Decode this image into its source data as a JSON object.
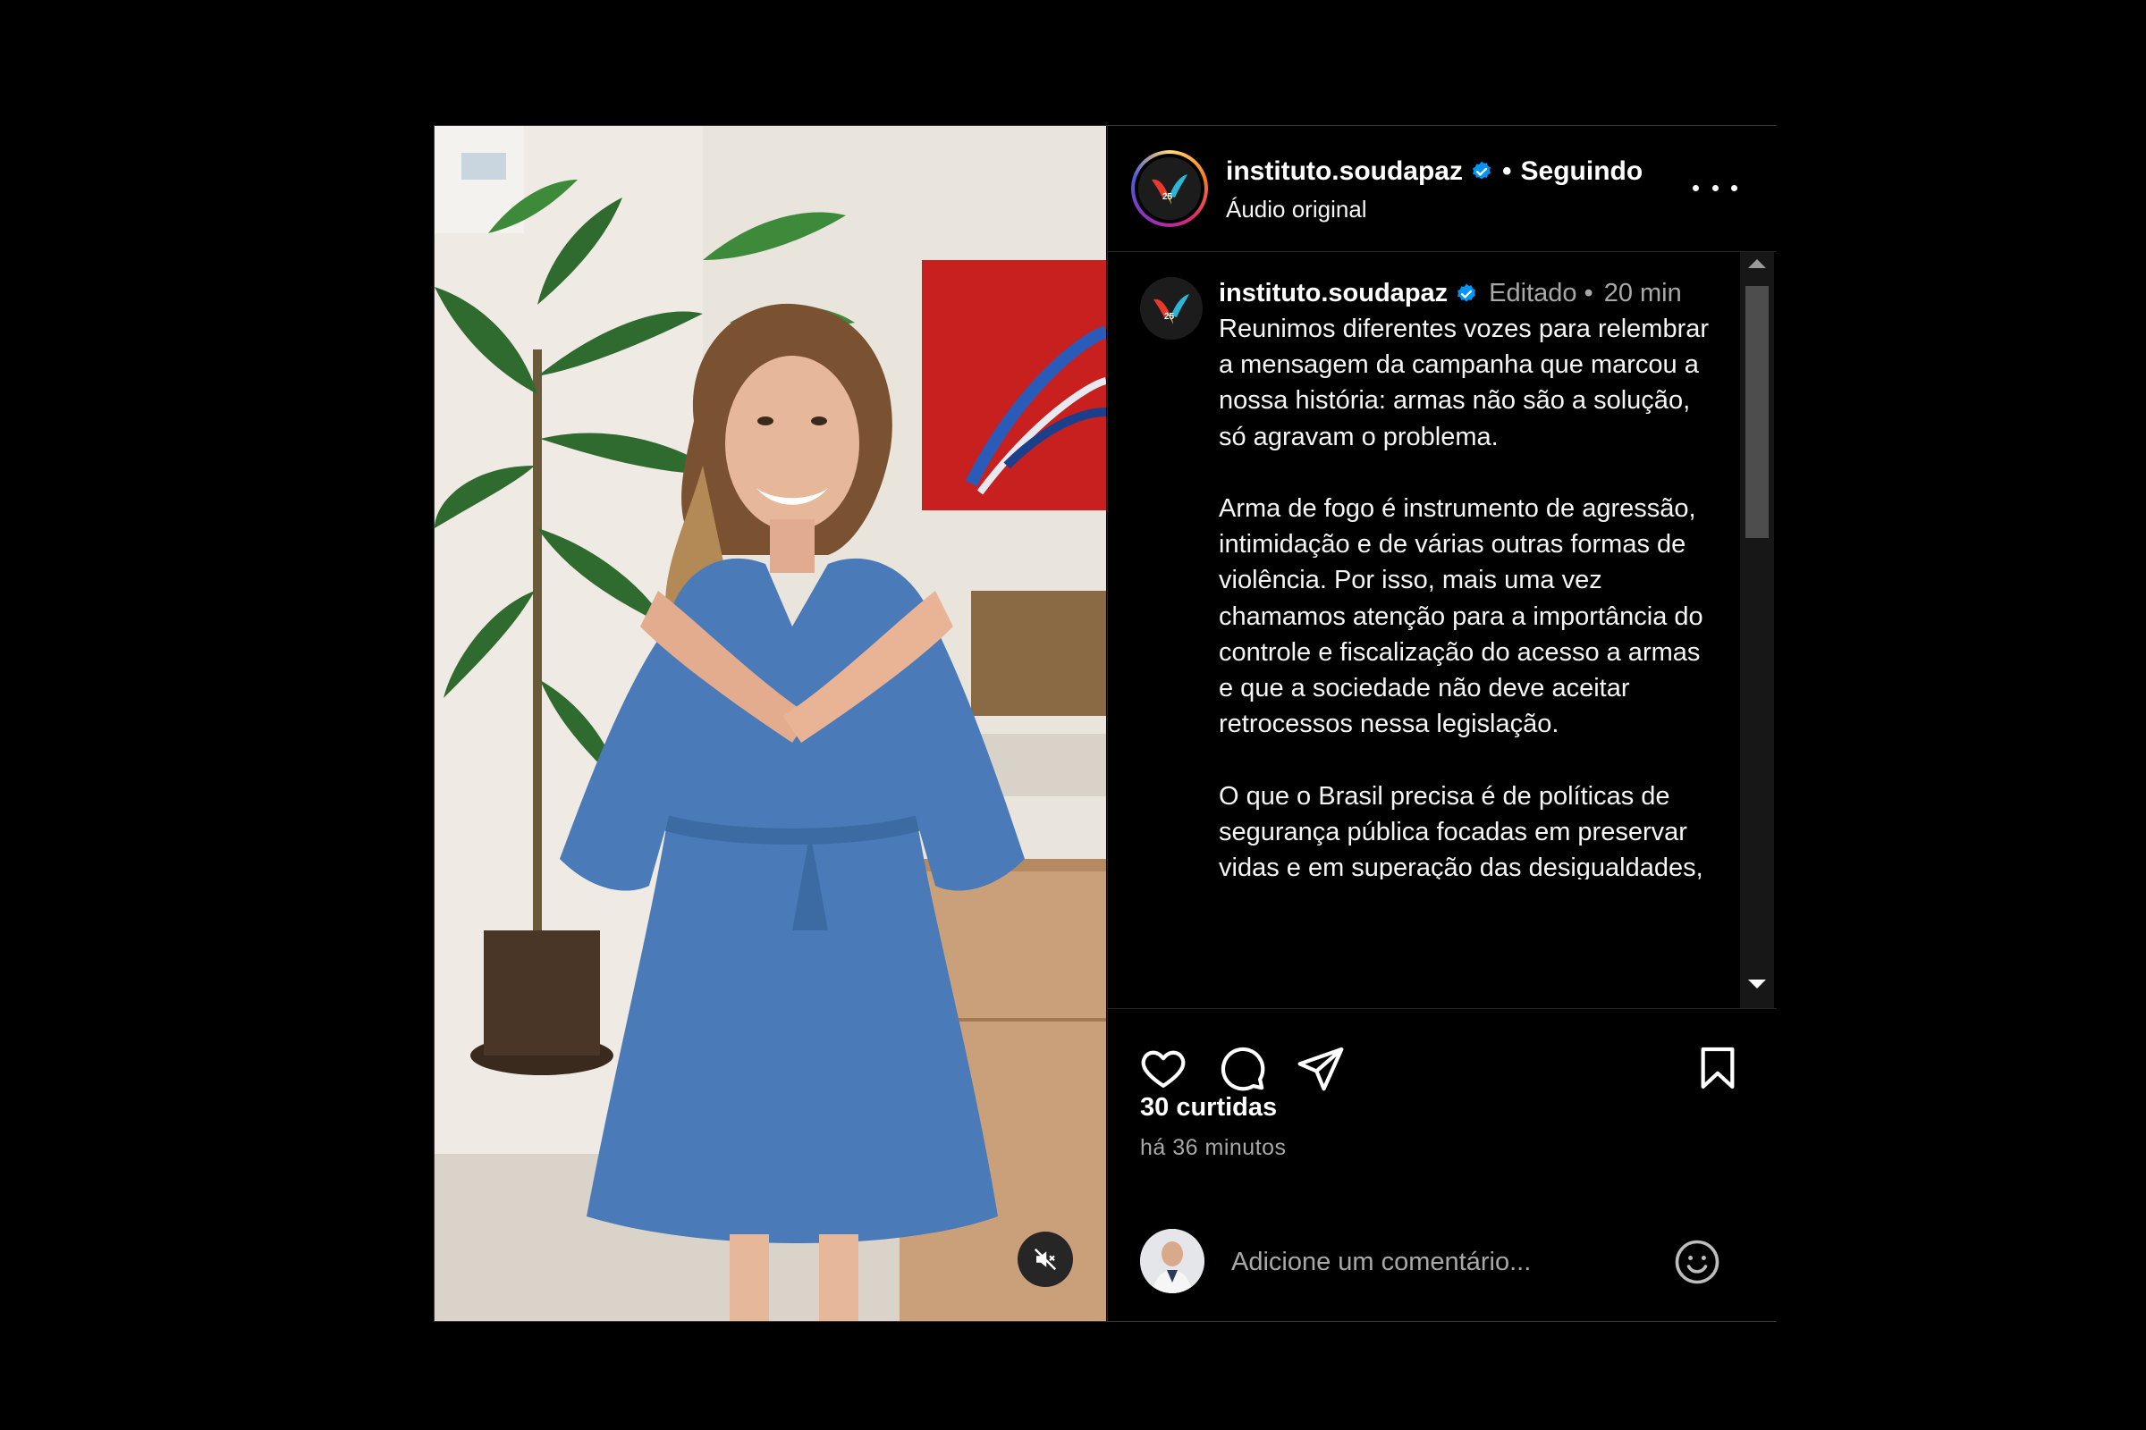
{
  "header": {
    "username": "instituto.soudapaz",
    "separator": "•",
    "follow_label": "Seguindo",
    "audio_label": "Áudio original"
  },
  "caption": {
    "username": "instituto.soudapaz",
    "edited_label": "Editado",
    "meta_separator": "•",
    "time_label": "20 min",
    "text": "Reunimos diferentes vozes para relembrar a mensagem da campanha que marcou a nossa história: armas não são a solução, só agravam o problema.\n\nArma de fogo é instrumento de agressão, intimidação e de várias outras formas de violência. Por isso, mais uma vez chamamos atenção para a importância do controle e fiscalização do acesso a armas e que a sociedade não deve aceitar retrocessos nessa legislação.\n\nO que o Brasil precisa é de políticas de segurança pública focadas em preservar vidas e em superação das desigualdades, para que seja possível construir um país mais justo e seguro,"
  },
  "post_stats": {
    "likes_label": "30 curtidas",
    "time_ago": "há 36 minutos"
  },
  "comment": {
    "placeholder": "Adicione um comentário..."
  },
  "icons": {
    "like": "heart-icon",
    "comment": "speech-bubble-icon",
    "share": "paper-plane-icon",
    "save": "bookmark-icon",
    "more": "ellipsis-icon",
    "mute": "speaker-muted-icon",
    "emoji": "smiley-icon",
    "verified": "verified-badge-icon"
  },
  "colors": {
    "background": "#000000",
    "verified_blue": "#0095f6",
    "secondary_text": "#a8a8a8",
    "border": "#262626"
  }
}
